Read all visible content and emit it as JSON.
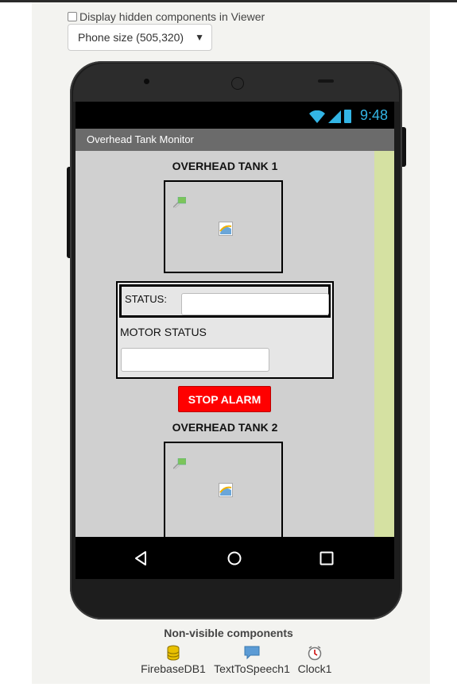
{
  "viewer": {
    "hidden_components_label": "Display hidden components in Viewer",
    "phone_size_selected": "Phone size (505,320)"
  },
  "statusbar": {
    "time": "9:48"
  },
  "app": {
    "title": "Overhead Tank Monitor"
  },
  "screen": {
    "tank1_title": "OVERHEAD TANK 1",
    "tank2_title": "OVERHEAD TANK 2",
    "status_label": "STATUS:",
    "motor_status_label": "MOTOR STATUS",
    "stop_alarm_label": "STOP ALARM"
  },
  "non_visible": {
    "title": "Non-visible components",
    "items": [
      {
        "label": "FirebaseDB1",
        "icon": "database-icon"
      },
      {
        "label": "TextToSpeech1",
        "icon": "speech-bubble-icon"
      },
      {
        "label": "Clock1",
        "icon": "clock-icon"
      }
    ]
  },
  "colors": {
    "stop_button": "#ff0000",
    "status_bar_accent": "#33b5e5",
    "screen_background": "#d0d0d0",
    "side_strip": "#d5e1a2"
  }
}
